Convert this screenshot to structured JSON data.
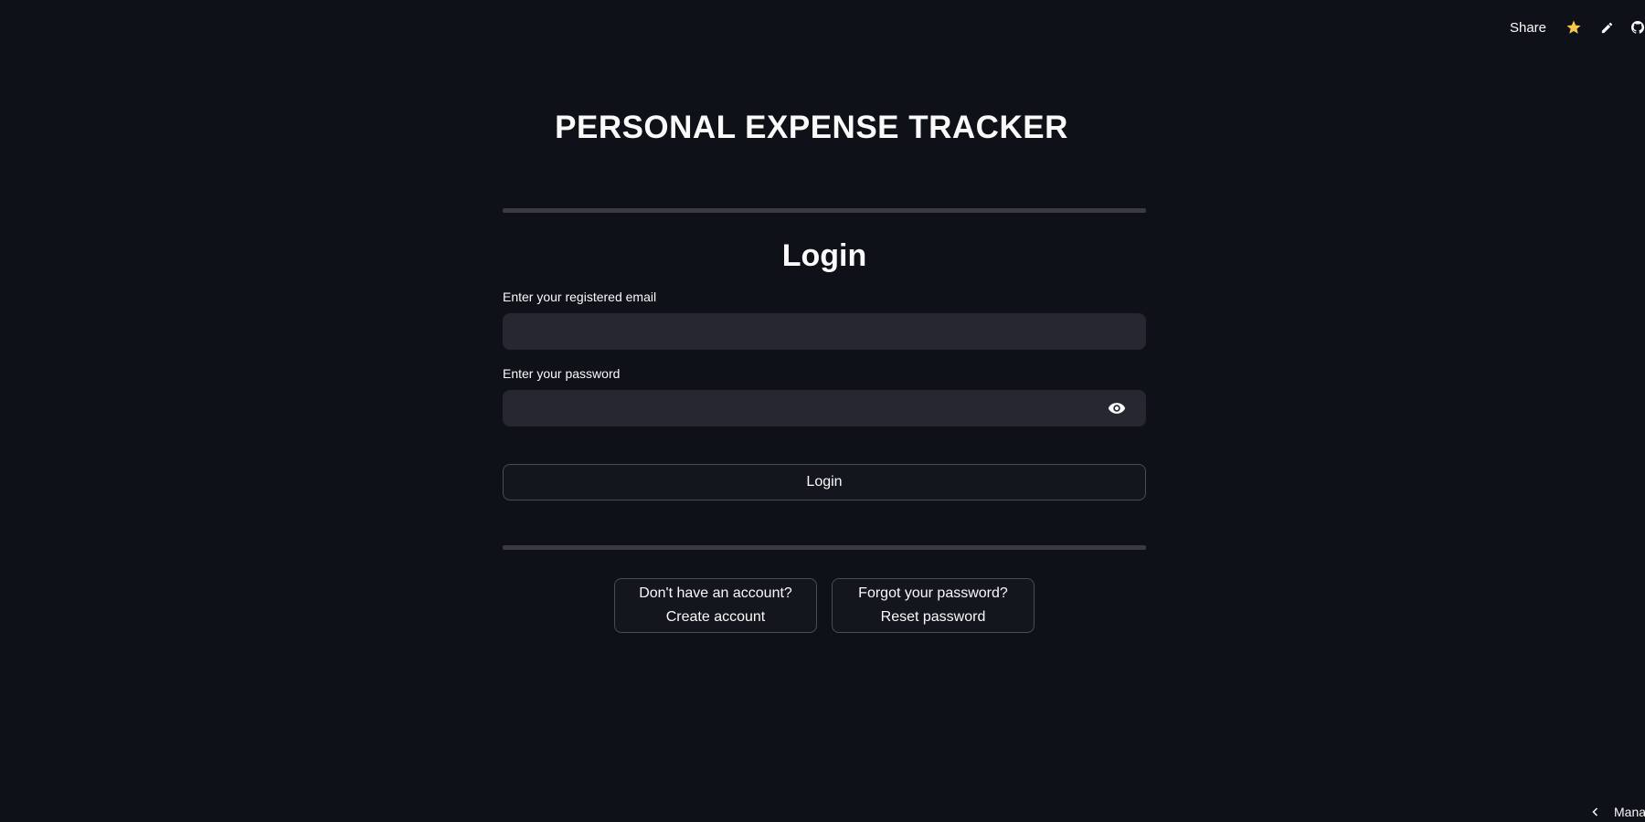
{
  "toolbar": {
    "share_label": "Share",
    "icons": [
      "star-icon",
      "pencil-icon",
      "github-icon"
    ],
    "star_color": "#f7c948"
  },
  "app": {
    "title": "PERSONAL EXPENSE TRACKER"
  },
  "login": {
    "heading": "Login",
    "email_label": "Enter your registered email",
    "email_value": "",
    "password_label": "Enter your password",
    "password_value": "",
    "submit_label": "Login"
  },
  "links": {
    "signup_prompt": "Don't have an account?",
    "signup_action": "Create account",
    "reset_prompt": "Forgot your password?",
    "reset_action": "Reset password"
  },
  "footer": {
    "manage_label": "Mana"
  },
  "colors": {
    "background": "#0e1117",
    "input_background": "#262730",
    "divider": "#3a3b3f",
    "text": "#fafafa"
  }
}
